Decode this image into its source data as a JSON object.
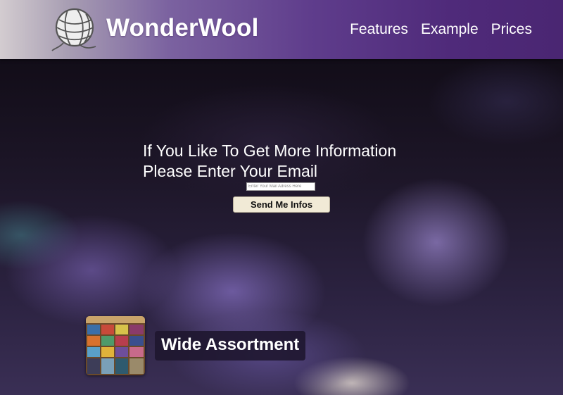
{
  "header": {
    "brand": "WonderWool",
    "logo_icon": "yarn-ball-icon",
    "nav": [
      {
        "label": "Features"
      },
      {
        "label": "Example"
      },
      {
        "label": "Prices"
      }
    ]
  },
  "cta": {
    "line1": "If You Like To Get More Information",
    "line2": "Please Enter Your Email",
    "email_placeholder": "Enter Your Mail Adress Here",
    "button_label": "Send Me Infos"
  },
  "feature": {
    "label": "Wide Assortment",
    "thumb_icon": "yarn-assortment-image"
  },
  "colors": {
    "header_start": "#d3ccd0",
    "header_end": "#4a2672",
    "button_bg": "#f1ead6",
    "text": "#ffffff"
  }
}
